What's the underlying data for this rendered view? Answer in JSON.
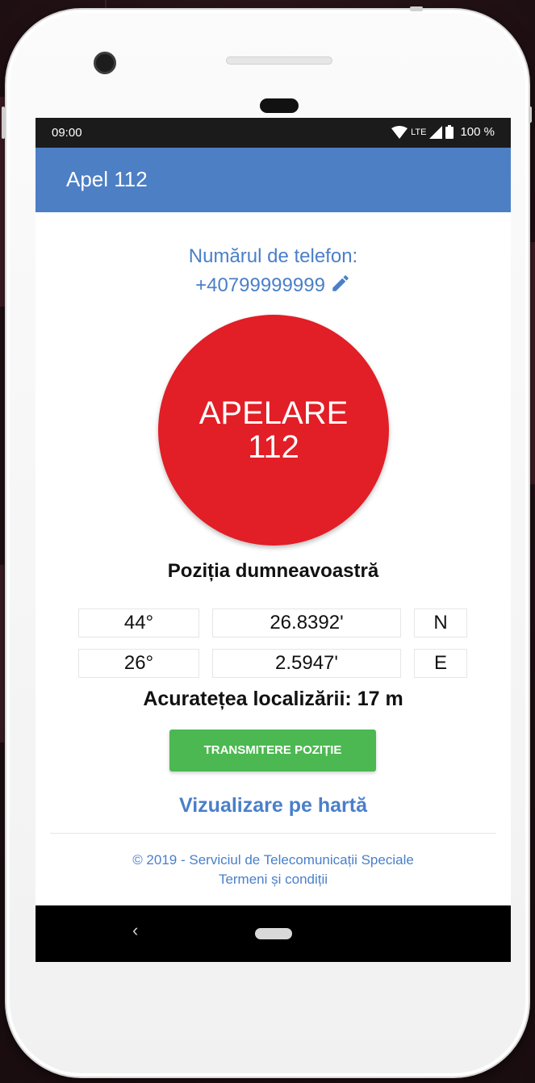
{
  "status_bar": {
    "time": "09:00",
    "network": "LTE",
    "battery": "100 %"
  },
  "app_bar": {
    "title": "Apel 112"
  },
  "phone": {
    "label": "Numărul de telefon:",
    "number": "+40799999999"
  },
  "call_button": {
    "line1": "APELARE",
    "line2": "112"
  },
  "position": {
    "title": "Poziția dumneavoastră",
    "lat": {
      "degrees": "44°",
      "minutes": "26.8392'",
      "hemisphere": "N"
    },
    "lon": {
      "degrees": "26°",
      "minutes": "2.5947'",
      "hemisphere": "E"
    },
    "accuracy": "Acuratețea localizării: 17 m"
  },
  "actions": {
    "send_position": "TRANSMITERE POZIȚIE",
    "view_on_map": "Vizualizare pe hartă"
  },
  "footer": {
    "copyright": "© 2019 - Serviciul de Telecomunicații Speciale",
    "terms": "Termeni și condiții"
  },
  "nav_bar": {
    "back": "‹"
  },
  "colors": {
    "app_bar": "#4d7fc4",
    "call_button": "#e21e26",
    "send_button": "#4cb851",
    "link": "#4a7fc9"
  }
}
